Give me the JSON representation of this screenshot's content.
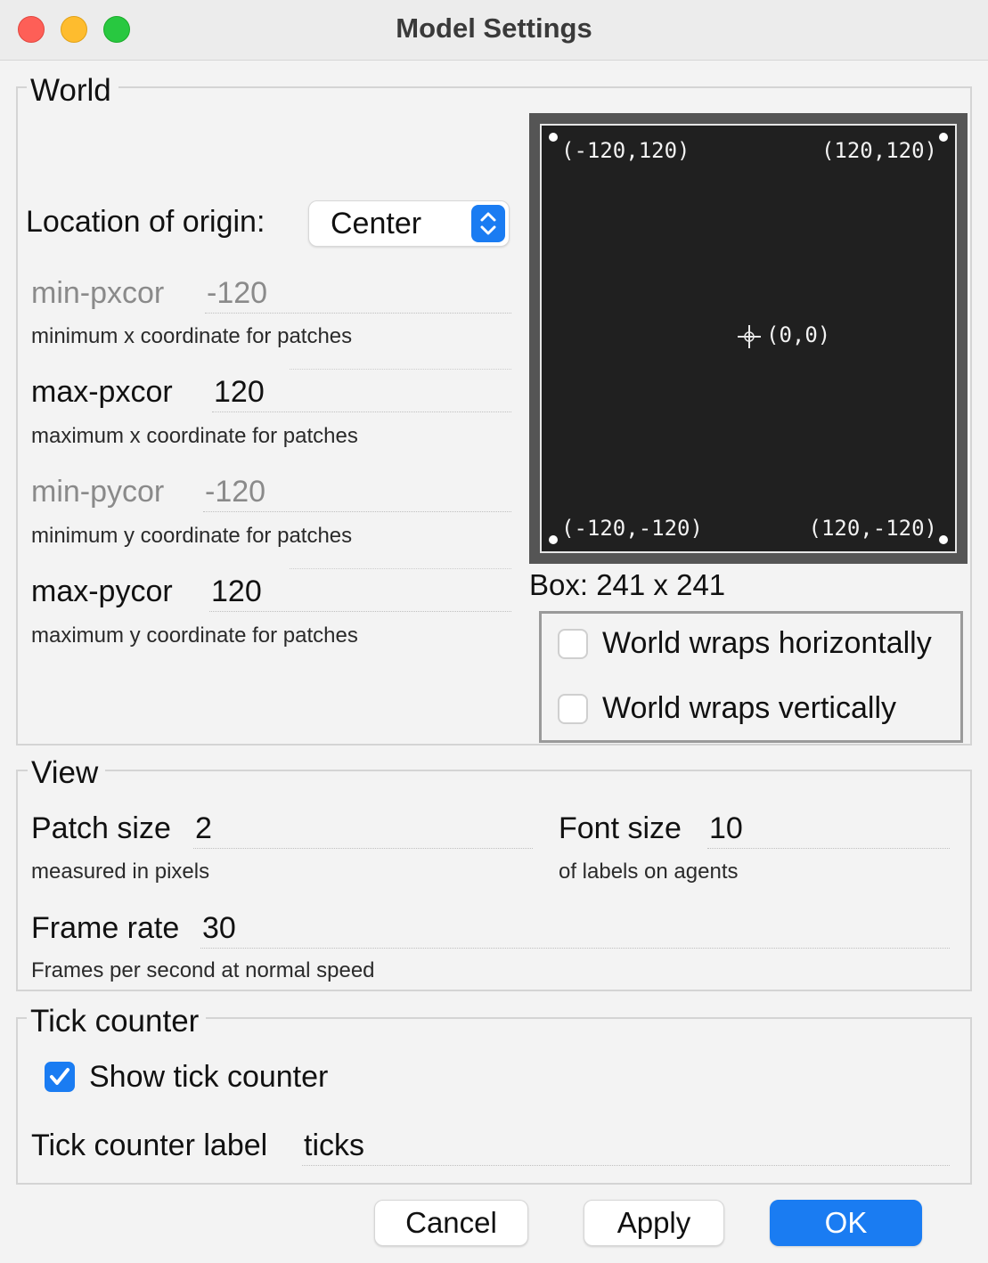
{
  "window": {
    "title": "Model Settings"
  },
  "world": {
    "group_title": "World",
    "origin_label": "Location of origin:",
    "origin_value": "Center",
    "min_pxcor": {
      "label": "min-pxcor",
      "value": "-120",
      "help": "minimum x coordinate for patches"
    },
    "max_pxcor": {
      "label": "max-pxcor",
      "value": "120",
      "help": "maximum x coordinate for patches"
    },
    "min_pycor": {
      "label": "min-pycor",
      "value": "-120",
      "help": "minimum y coordinate for patches"
    },
    "max_pycor": {
      "label": "max-pycor",
      "value": "120",
      "help": "maximum y coordinate for patches"
    },
    "preview": {
      "top_left": "(-120,120)",
      "top_right": "(120,120)",
      "origin": "(0,0)",
      "bottom_left": "(-120,-120)",
      "bottom_right": "(120,-120)"
    },
    "box_size": "Box: 241 x 241",
    "wrap_horizontal": {
      "label": "World wraps horizontally",
      "checked": false
    },
    "wrap_vertical": {
      "label": "World wraps vertically",
      "checked": false
    }
  },
  "view": {
    "group_title": "View",
    "patch_size": {
      "label": "Patch size",
      "value": "2",
      "help": "measured in pixels"
    },
    "font_size": {
      "label": "Font size",
      "value": "10",
      "help": "of labels on agents"
    },
    "frame_rate": {
      "label": "Frame rate",
      "value": "30",
      "help": "Frames per second at normal speed"
    }
  },
  "tick_counter": {
    "group_title": "Tick counter",
    "show_label": "Show tick counter",
    "show_checked": true,
    "label_label": "Tick counter label",
    "label_value": "ticks"
  },
  "buttons": {
    "cancel": "Cancel",
    "apply": "Apply",
    "ok": "OK"
  },
  "colors": {
    "accent": "#1a7cf2",
    "preview_bg": "#202020"
  }
}
